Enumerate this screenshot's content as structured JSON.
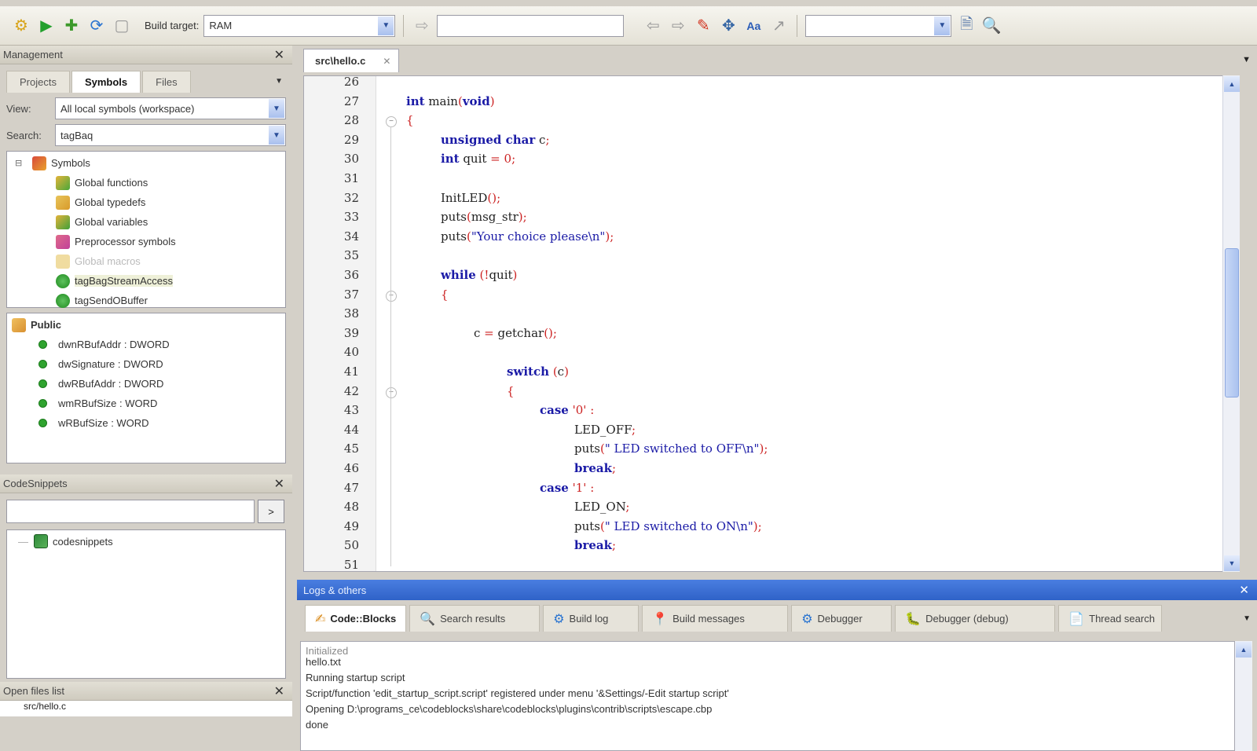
{
  "toolbar": {
    "build_target_label": "Build target:",
    "build_target_value": "RAM",
    "search_value": "",
    "search2_value": ""
  },
  "management": {
    "title": "Management",
    "tabs": [
      "Projects",
      "Symbols",
      "Files"
    ],
    "view_label": "View:",
    "view_value": "All local symbols (workspace)",
    "search_label": "Search:",
    "search_value": "tagBaq",
    "tree": {
      "root": "Symbols",
      "children": [
        "Global functions",
        "Global typedefs",
        "Global variables",
        "Preprocessor symbols",
        "Global macros",
        "tagBagStreamAccess",
        "tagSendOBuffer"
      ]
    },
    "public": {
      "title": "Public",
      "members": [
        "dwnRBufAddr : DWORD",
        "dwSignature : DWORD",
        "dwRBufAddr : DWORD",
        "wmRBufSize : WORD",
        "wRBufSize : WORD"
      ]
    }
  },
  "codesnippets": {
    "title": "CodeSnippets",
    "search_value": "",
    "go_label": ">",
    "root": "codesnippets"
  },
  "open_files": {
    "title": "Open files list",
    "first_item": "src/hello.c"
  },
  "editor": {
    "tab_label": "src\\hello.c",
    "line_numbers": [
      "26",
      "27",
      "28",
      "29",
      "30",
      "31",
      "32",
      "33",
      "34",
      "35",
      "36",
      "37",
      "38",
      "39",
      "40",
      "41",
      "42",
      "43",
      "44",
      "45",
      "46",
      "47",
      "48",
      "49",
      "50",
      "51"
    ]
  },
  "logs": {
    "title": "Logs & others",
    "tabs": [
      "Code::Blocks",
      "Search results",
      "Build log",
      "Build messages",
      "Debugger",
      "Debugger (debug)",
      "Thread search"
    ],
    "tab_icons": [
      "✍",
      "🔍",
      "⚙",
      "📍",
      "⚙",
      "🐛",
      "📄"
    ],
    "lines": [
      "Initialized",
      "hello.txt",
      "Running startup script",
      "Script/function 'edit_startup_script.script' registered under menu '&Settings/-Edit startup script'",
      "Opening D:\\programs_ce\\codeblocks\\share\\codeblocks\\plugins\\contrib\\scripts\\escape.cbp",
      "done"
    ]
  },
  "colors": {
    "keyword": "#1a1aa6",
    "number": "#cc2222",
    "logs_titlebar": "#2f62c8"
  }
}
